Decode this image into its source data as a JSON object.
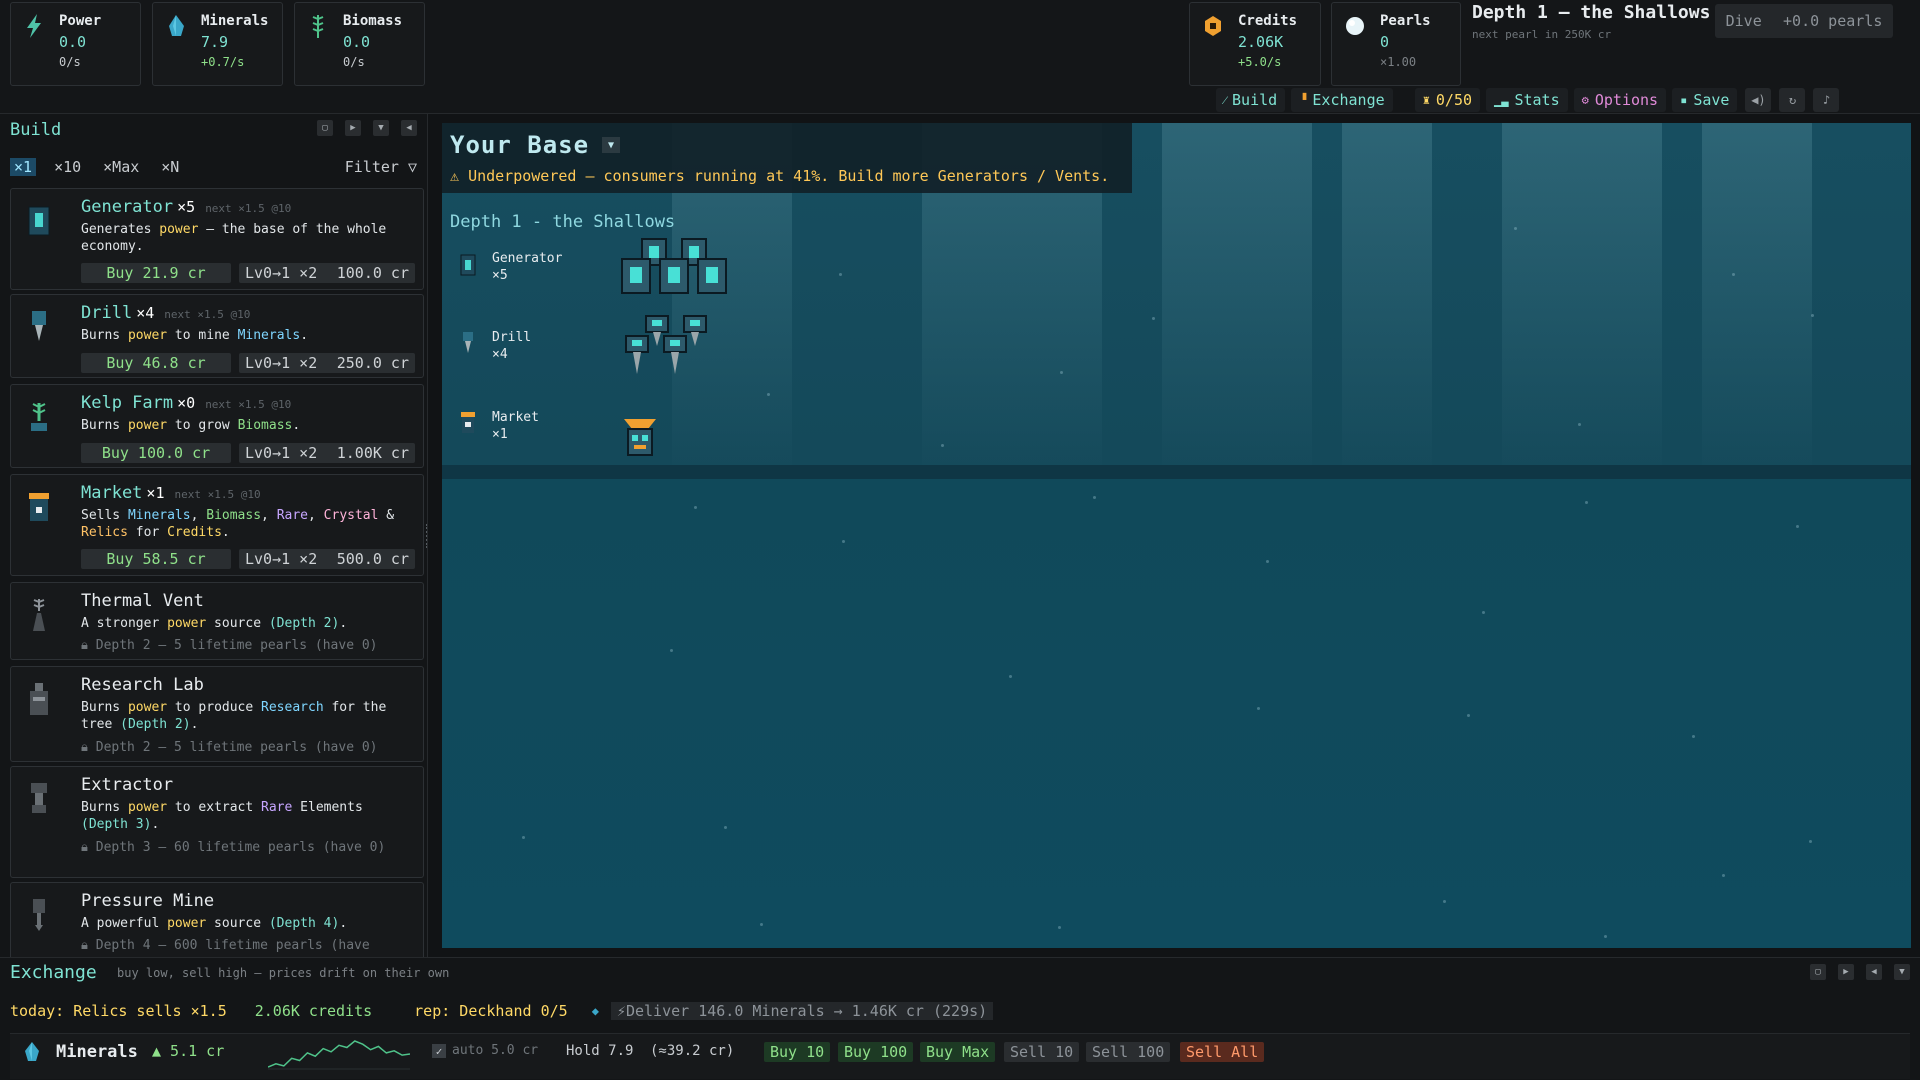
{
  "resources": {
    "power": {
      "label": "Power",
      "value": "0.0",
      "rate": "0/s"
    },
    "minerals": {
      "label": "Minerals",
      "value": "7.9",
      "rate": "+0.7/s"
    },
    "biomass": {
      "label": "Biomass",
      "value": "0.0",
      "rate": "0/s"
    },
    "credits": {
      "label": "Credits",
      "value": "2.06K",
      "rate": "+5.0/s"
    },
    "pearls": {
      "label": "Pearls",
      "value": "0",
      "rate": "×1.00"
    }
  },
  "depth": {
    "title": "Depth 1 — the Shallows",
    "subtitle": "next pearl in 250K cr",
    "dive_label": "Dive",
    "dive_value": "+0.0 pearls"
  },
  "toolbar": {
    "build": "Build",
    "exchange": "Exchange",
    "achievements": "0/50",
    "stats": "Stats",
    "options": "Options",
    "save": "Save"
  },
  "build": {
    "title": "Build",
    "qty": [
      "×1",
      "×10",
      "×Max",
      "×N"
    ],
    "filter": "Filter ▽",
    "items": [
      {
        "name": "Generator",
        "count": "×5",
        "next": "next ×1.5 @10",
        "buy": "Buy 21.9 cr",
        "lv": "Lv0→1 ×2",
        "lv_cost": "100.0 cr"
      },
      {
        "name": "Drill",
        "count": "×4",
        "next": "next ×1.5 @10",
        "buy": "Buy 46.8 cr",
        "lv": "Lv0→1 ×2",
        "lv_cost": "250.0 cr"
      },
      {
        "name": "Kelp Farm",
        "count": "×0",
        "next": "next ×1.5 @10",
        "buy": "Buy 100.0 cr",
        "lv": "Lv0→1 ×2",
        "lv_cost": "1.00K cr"
      },
      {
        "name": "Market",
        "count": "×1",
        "next": "next ×1.5 @10",
        "buy": "Buy 58.5 cr",
        "lv": "Lv0→1 ×2",
        "lv_cost": "500.0 cr"
      }
    ],
    "locked": [
      {
        "name": "Thermal Vent",
        "req": "Depth 2 — 5 lifetime pearls (have 0)"
      },
      {
        "name": "Research Lab",
        "req": "Depth 2 — 5 lifetime pearls (have 0)"
      },
      {
        "name": "Extractor",
        "req": "Depth 3 — 60 lifetime pearls (have 0)"
      },
      {
        "name": "Pressure Mine",
        "req": "Depth 4 — 600 lifetime pearls (have"
      }
    ]
  },
  "base": {
    "title": "Your Base",
    "warning": "Underpowered — consumers running at 41%. Build more Generators / Vents.",
    "depth_label": "Depth 1 - the Shallows",
    "structures": [
      {
        "name": "Generator",
        "count": "×5"
      },
      {
        "name": "Drill",
        "count": "×4"
      },
      {
        "name": "Market",
        "count": "×1"
      }
    ]
  },
  "exchange": {
    "title": "Exchange",
    "subtitle": "buy low, sell high — prices drift on their own",
    "today": "today: Relics sells ×1.5",
    "credits": "2.06K credits",
    "rep": "rep: Deckhand 0/5",
    "deliver": "⚡Deliver 146.0 Minerals → 1.46K cr (229s)",
    "row": {
      "name": "Minerals",
      "price": "▲ 5.1 cr",
      "auto": "auto 5.0 cr",
      "hold": "Hold 7.9",
      "hold_value": "(≈39.2 cr)",
      "buttons": [
        "Buy 10",
        "Buy 100",
        "Buy Max",
        "Sell 10",
        "Sell 100",
        "Sell All"
      ]
    },
    "price_history": [
      3.6,
      3.9,
      3.7,
      4.4,
      4.2,
      4.9,
      4.6,
      5.3,
      5.0,
      5.6,
      5.4,
      6.0,
      5.7,
      5.2,
      5.5,
      4.9,
      5.1,
      4.7,
      4.8
    ]
  },
  "colors": {
    "accent": "#7fe3d3",
    "warn": "#ffc857",
    "buy": "#8fe08a",
    "sell_all": "#ff9a6b"
  }
}
